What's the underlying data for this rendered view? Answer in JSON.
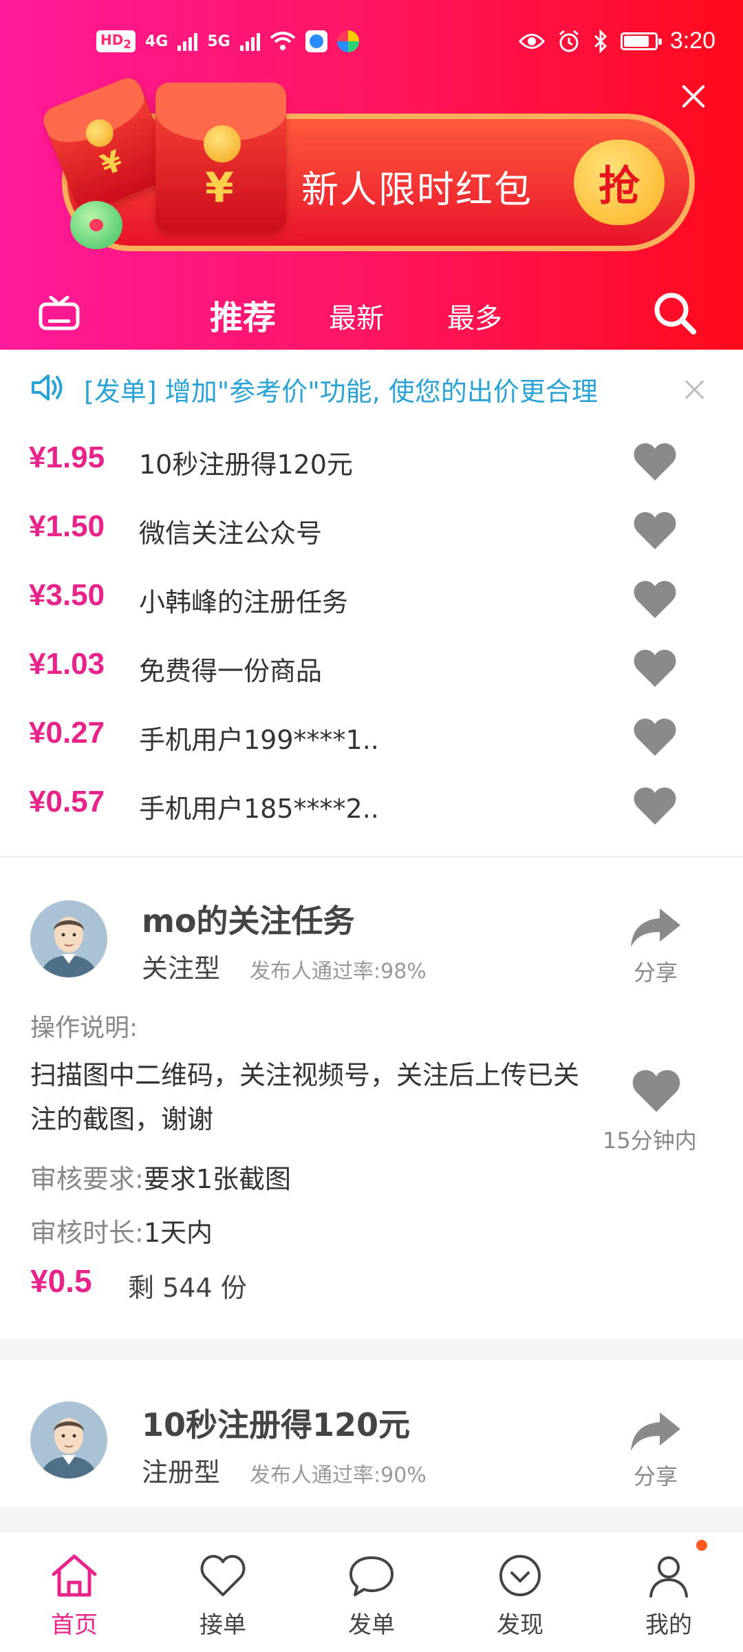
{
  "status_bar": {
    "hd_label": "HD",
    "hd_sub": "2",
    "net1": "4G",
    "net2": "5G",
    "time": "3:20",
    "icons": [
      "eye-icon",
      "alarm-icon",
      "bluetooth-icon",
      "battery-icon"
    ],
    "battery_level": 0.75
  },
  "banner": {
    "text": "新人限时红包",
    "button_label": "抢",
    "packet_symbol": "¥"
  },
  "tabs": [
    {
      "label": "推荐",
      "active": true
    },
    {
      "label": "最新",
      "active": false
    },
    {
      "label": "最多",
      "active": false
    }
  ],
  "notice": {
    "text": "[发单] 增加\"参考价\"功能, 使您的出价更合理"
  },
  "quick_list": [
    {
      "price": "¥1.95",
      "title": "10秒注册得120元"
    },
    {
      "price": "¥1.50",
      "title": "微信关注公众号"
    },
    {
      "price": "¥3.50",
      "title": "小韩峰的注册任务"
    },
    {
      "price": "¥1.03",
      "title": "免费得一份商品"
    },
    {
      "price": "¥0.27",
      "title": "手机用户199****1.."
    },
    {
      "price": "¥0.57",
      "title": "手机用户185****2.."
    }
  ],
  "tasks": [
    {
      "title": "mo的关注任务",
      "type": "关注型",
      "rate": "发布人通过率:98%",
      "share_label": "分享",
      "op_label": "操作说明:",
      "op_desc": "扫描图中二维码，关注视频号，关注后上传已关注的截图，谢谢",
      "time_limit": "15分钟内",
      "review_req_label": "审核要求:",
      "review_req_value": "要求1张截图",
      "review_dur_label": "审核时长:",
      "review_dur_value": "1天内",
      "reward": "¥0.5",
      "remaining": "剩 544 份"
    },
    {
      "title": "10秒注册得120元",
      "type": "注册型",
      "rate": "发布人通过率:90%",
      "share_label": "分享"
    }
  ],
  "bottom_nav": [
    {
      "label": "首页",
      "icon": "home-icon",
      "active": true
    },
    {
      "label": "接单",
      "icon": "heart-icon",
      "active": false
    },
    {
      "label": "发单",
      "icon": "chat-icon",
      "active": false
    },
    {
      "label": "发现",
      "icon": "discover-icon",
      "active": false
    },
    {
      "label": "我的",
      "icon": "profile-icon",
      "active": false,
      "badge_dot": true
    }
  ],
  "colors": {
    "accent": "#e8238a",
    "header_start": "#ff1a9b",
    "header_end": "#ff0a1a",
    "notice_text": "#29a3d6",
    "heart_gray": "#8a8a8a"
  }
}
